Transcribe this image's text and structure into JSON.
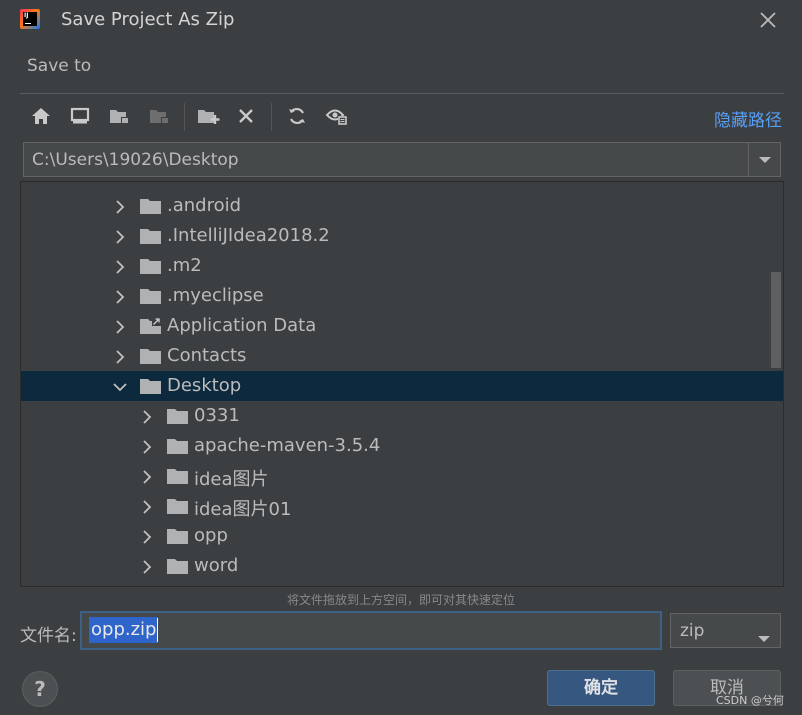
{
  "window": {
    "title": "Save Project As Zip"
  },
  "save_to_label": "Save to",
  "toolbar": {
    "buttons": [
      "home-icon",
      "desktop-icon",
      "project-folder-icon",
      "module-folder-icon",
      "new-folder-icon",
      "delete-icon",
      "refresh-icon",
      "show-hidden-icon"
    ],
    "hide_path_label": "隐藏路径"
  },
  "path": {
    "value": "C:\\Users\\19026\\Desktop"
  },
  "tree": {
    "items": [
      {
        "label": ".android",
        "expanded": false,
        "level": 1
      },
      {
        "label": ".IntelliJIdea2018.2",
        "expanded": false,
        "level": 1
      },
      {
        "label": ".m2",
        "expanded": false,
        "level": 1
      },
      {
        "label": ".myeclipse",
        "expanded": false,
        "level": 1
      },
      {
        "label": "Application Data",
        "expanded": false,
        "level": 1,
        "link": true
      },
      {
        "label": "Contacts",
        "expanded": false,
        "level": 1
      },
      {
        "label": "Desktop",
        "expanded": true,
        "level": 1,
        "selected": true
      },
      {
        "label": "0331",
        "expanded": false,
        "level": 2
      },
      {
        "label": "apache-maven-3.5.4",
        "expanded": false,
        "level": 2
      },
      {
        "label": "idea图片",
        "expanded": false,
        "level": 2
      },
      {
        "label": "idea图片01",
        "expanded": false,
        "level": 2
      },
      {
        "label": "opp",
        "expanded": false,
        "level": 2
      },
      {
        "label": "word",
        "expanded": false,
        "level": 2
      }
    ]
  },
  "hint": "将文件拖放到上方空间，即可对其快速定位",
  "filename": {
    "label": "文件名:",
    "value": "opp.zip"
  },
  "extension": {
    "selected": "zip"
  },
  "buttons": {
    "help": "?",
    "ok": "确定",
    "cancel": "取消"
  },
  "watermark": "CSDN @兮何",
  "colors": {
    "background": "#3c3f41",
    "selection": "#0d293e",
    "link": "#589df6",
    "primary_button": "#365880",
    "text_selection": "#2f65ca"
  }
}
